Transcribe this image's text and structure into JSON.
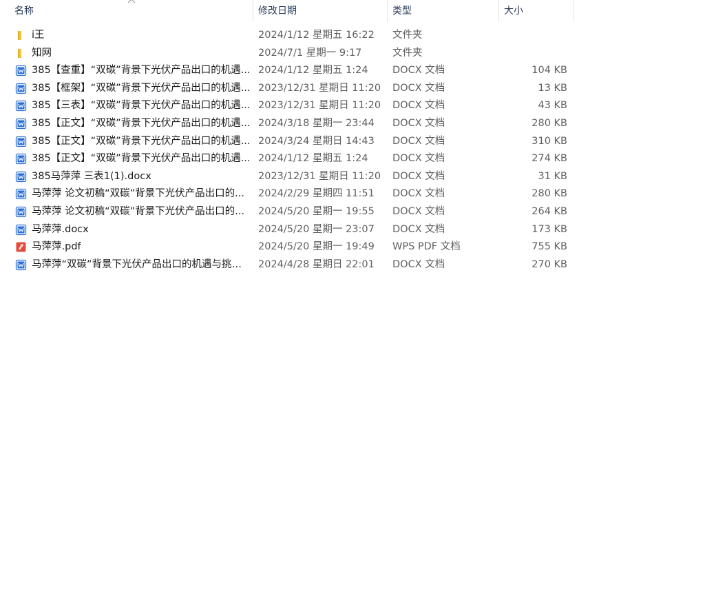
{
  "columns": {
    "name": "名称",
    "date": "修改日期",
    "type": "类型",
    "size": "大小"
  },
  "sort": {
    "column": "name",
    "direction": "ascending"
  },
  "colors": {
    "folder": "#f4c542",
    "docx": "#2b6fd6",
    "pdf": "#e54b3c"
  },
  "files": [
    {
      "icon": "folder-icon",
      "kind": "folder",
      "name": "i王",
      "date": "2024/1/12 星期五 16:22",
      "type": "文件夹",
      "size": ""
    },
    {
      "icon": "folder-icon",
      "kind": "folder",
      "name": "知网",
      "date": "2024/7/1 星期一 9:17",
      "type": "文件夹",
      "size": ""
    },
    {
      "icon": "docx-file-icon",
      "kind": "docx",
      "name": "385【查重】“双碳”背景下光伏产品出口的机遇...",
      "date": "2024/1/12 星期五 1:24",
      "type": "DOCX 文档",
      "size": "104 KB"
    },
    {
      "icon": "docx-file-icon",
      "kind": "docx",
      "name": "385【框架】“双碳”背景下光伏产品出口的机遇...",
      "date": "2023/12/31 星期日 11:20",
      "type": "DOCX 文档",
      "size": "13 KB"
    },
    {
      "icon": "docx-file-icon",
      "kind": "docx",
      "name": "385【三表】“双碳”背景下光伏产品出口的机遇...",
      "date": "2023/12/31 星期日 11:20",
      "type": "DOCX 文档",
      "size": "43 KB"
    },
    {
      "icon": "docx-file-icon",
      "kind": "docx",
      "name": "385【正文】“双碳”背景下光伏产品出口的机遇...",
      "date": "2024/3/18 星期一 23:44",
      "type": "DOCX 文档",
      "size": "280 KB"
    },
    {
      "icon": "docx-file-icon",
      "kind": "docx",
      "name": "385【正文】“双碳”背景下光伏产品出口的机遇...",
      "date": "2024/3/24 星期日 14:43",
      "type": "DOCX 文档",
      "size": "310 KB"
    },
    {
      "icon": "docx-file-icon",
      "kind": "docx",
      "name": "385【正文】“双碳”背景下光伏产品出口的机遇...",
      "date": "2024/1/12 星期五 1:24",
      "type": "DOCX 文档",
      "size": "274 KB"
    },
    {
      "icon": "docx-file-icon",
      "kind": "docx",
      "name": "385马萍萍 三表1(1).docx",
      "date": "2023/12/31 星期日 11:20",
      "type": "DOCX 文档",
      "size": "31 KB"
    },
    {
      "icon": "docx-file-icon",
      "kind": "docx",
      "name": "马萍萍 论文初稿“双碳”背景下光伏产品出口的...",
      "date": "2024/2/29 星期四 11:51",
      "type": "DOCX 文档",
      "size": "280 KB"
    },
    {
      "icon": "docx-file-icon",
      "kind": "docx",
      "name": "马萍萍 论文初稿“双碳”背景下光伏产品出口的...",
      "date": "2024/5/20 星期一 19:55",
      "type": "DOCX 文档",
      "size": "264 KB"
    },
    {
      "icon": "docx-file-icon",
      "kind": "docx",
      "name": "马萍萍.docx",
      "date": "2024/5/20 星期一 23:07",
      "type": "DOCX 文档",
      "size": "173 KB"
    },
    {
      "icon": "pdf-file-icon",
      "kind": "pdf",
      "name": "马萍萍.pdf",
      "date": "2024/5/20 星期一 19:49",
      "type": "WPS PDF 文档",
      "size": "755 KB"
    },
    {
      "icon": "docx-file-icon",
      "kind": "docx",
      "name": "马萍萍“双碳”背景下光伏产品出口的机遇与挑战...",
      "date": "2024/4/28 星期日 22:01",
      "type": "DOCX 文档",
      "size": "270 KB"
    }
  ]
}
